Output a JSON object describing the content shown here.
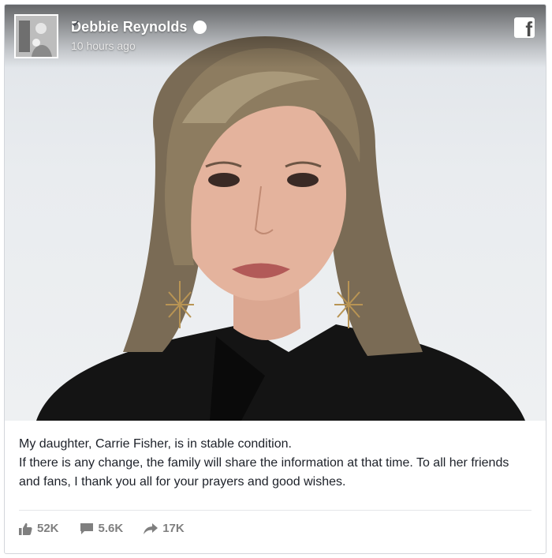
{
  "post": {
    "page_name": "Debbie Reynolds",
    "timestamp": "10 hours ago",
    "text_line1": "My daughter, Carrie Fisher, is in stable condition.",
    "text_line2": "If there is any change, the family will share the information at that time. To all her friends and fans, I thank you all for your prayers and good wishes."
  },
  "stats": {
    "likes": "52K",
    "comments": "5.6K",
    "shares": "17K"
  },
  "icons": {
    "verified": "verified-badge-icon",
    "facebook": "facebook-logo-icon",
    "like": "thumbs-up-icon",
    "comment": "comment-icon",
    "share": "share-arrow-icon"
  },
  "colors": {
    "text": "#1d2129",
    "stats": "#7f7f7f",
    "border": "#d3d6db"
  }
}
